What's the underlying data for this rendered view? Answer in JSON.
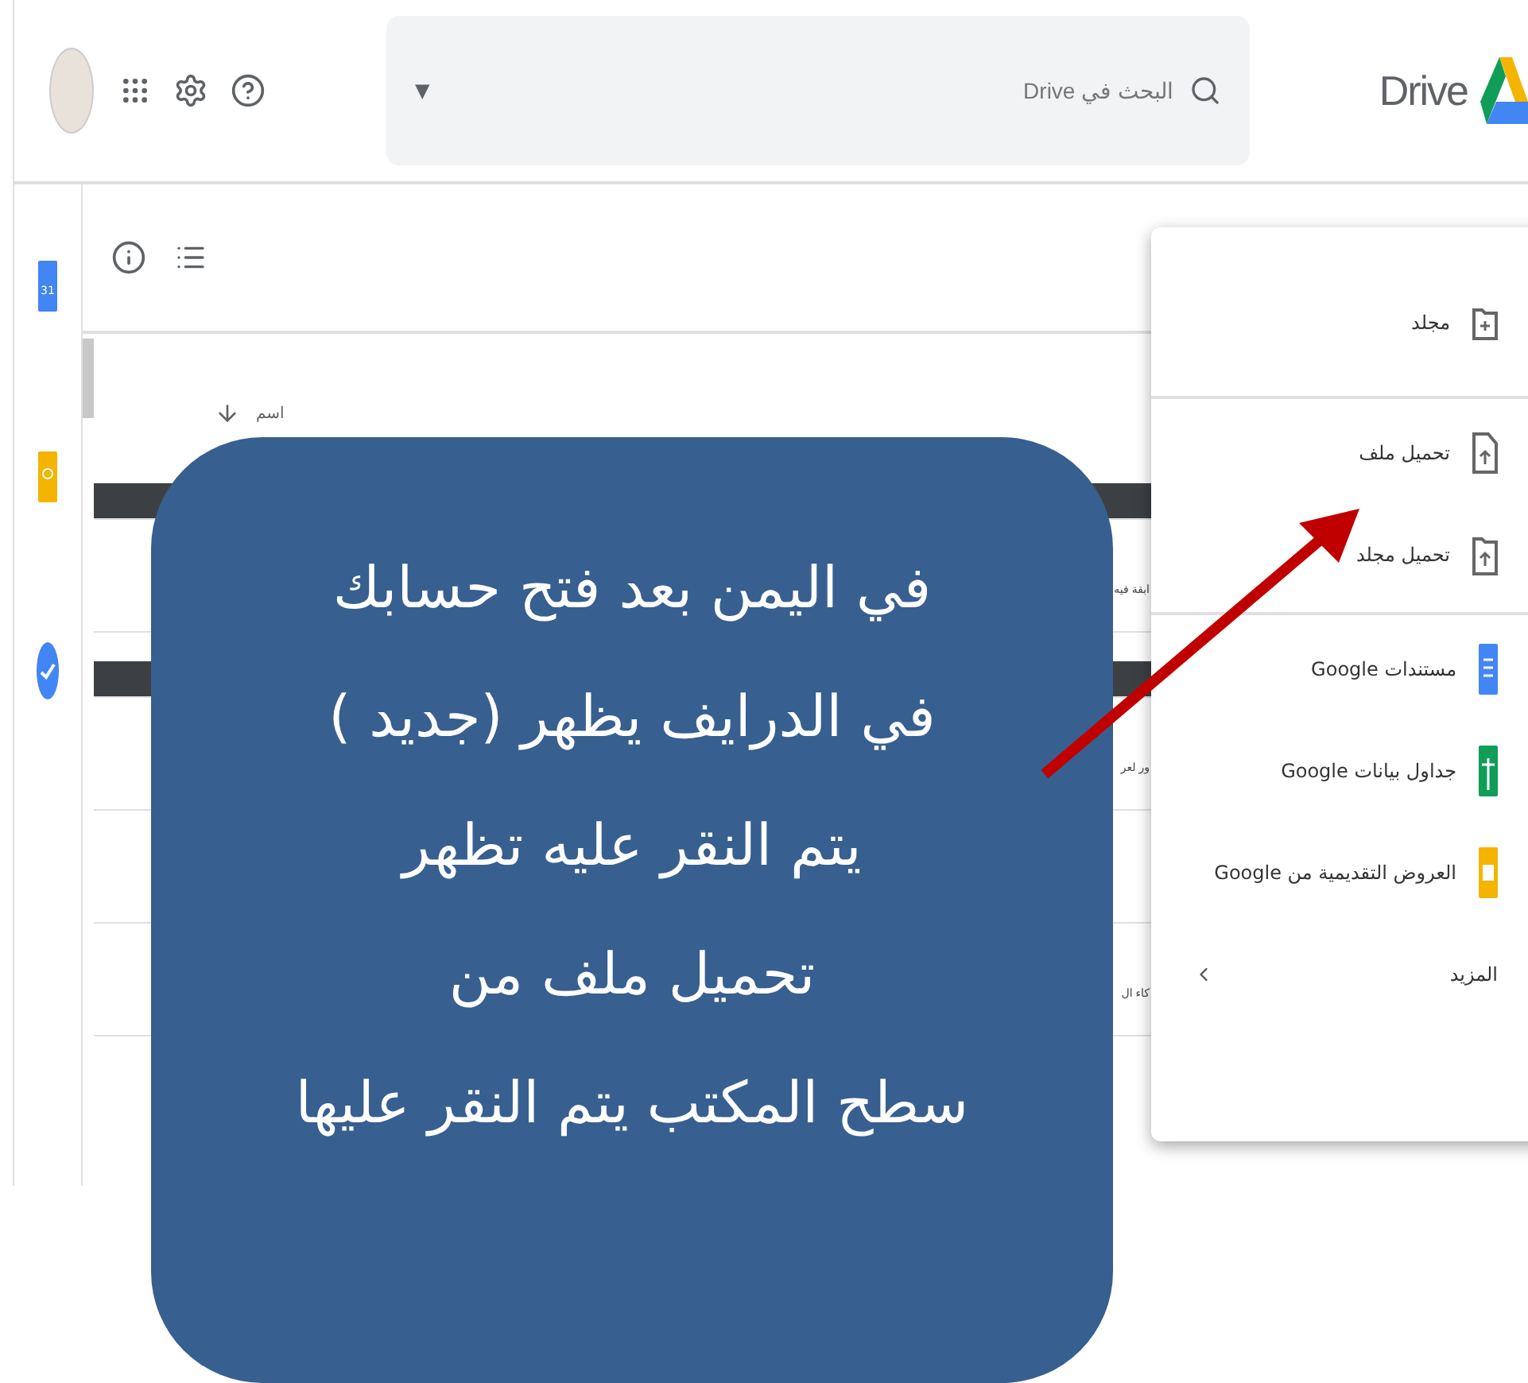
{
  "header": {
    "logo_text": "Drive",
    "search": {
      "placeholder": "البحث في Drive",
      "dropdown_glyph": "▼"
    },
    "calendar_day": "31"
  },
  "list": {
    "sort_column": "اسم",
    "rows": [
      {
        "kind": "band",
        "text": ""
      },
      {
        "kind": "text",
        "text": "ابقة فيه"
      },
      {
        "kind": "band",
        "text": ""
      },
      {
        "kind": "text",
        "text": "ور لعر"
      },
      {
        "kind": "blank",
        "text": ""
      },
      {
        "kind": "text",
        "text": "كاء ال"
      }
    ]
  },
  "new_menu": {
    "sections": [
      [
        {
          "kind": "folder",
          "label": "مجلد"
        }
      ],
      [
        {
          "kind": "file-upload",
          "label": "تحميل ملف"
        },
        {
          "kind": "folder-upload",
          "label": "تحميل مجلد"
        }
      ],
      [
        {
          "kind": "docs",
          "label": "مستندات Google"
        },
        {
          "kind": "sheets",
          "label": "جداول بيانات Google"
        },
        {
          "kind": "slides",
          "label": "العروض التقديمية من Google"
        },
        {
          "kind": "more",
          "label": "المزيد"
        }
      ]
    ]
  },
  "callout": {
    "lines": [
      "في اليمن بعد فتح حسابك",
      "في الدرايف يظهر (جديد )",
      "يتم النقر عليه  تظهر",
      "تحميل ملف من",
      "سطح المكتب  يتم النقر عليها"
    ]
  }
}
